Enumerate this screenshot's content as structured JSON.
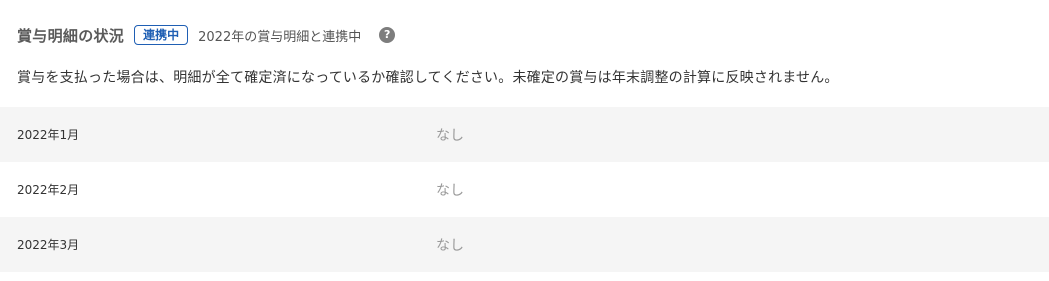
{
  "header": {
    "title": "賞与明細の状況",
    "badge": "連携中",
    "link_status": "2022年の賞与明細と連携中",
    "help_icon": "question-circle-icon"
  },
  "description": "賞与を支払った場合は、明細が全て確定済になっているか確認してください。未確定の賞与は年末調整の計算に反映されません。",
  "rows": [
    {
      "month": "2022年1月",
      "value": "なし"
    },
    {
      "month": "2022年2月",
      "value": "なし"
    },
    {
      "month": "2022年3月",
      "value": "なし"
    }
  ],
  "colors": {
    "badge_accent": "#1f5fb4",
    "row_shade": "#f5f5f5",
    "muted_text": "#9a9a9a",
    "help_icon_bg": "#7d7d7d"
  }
}
